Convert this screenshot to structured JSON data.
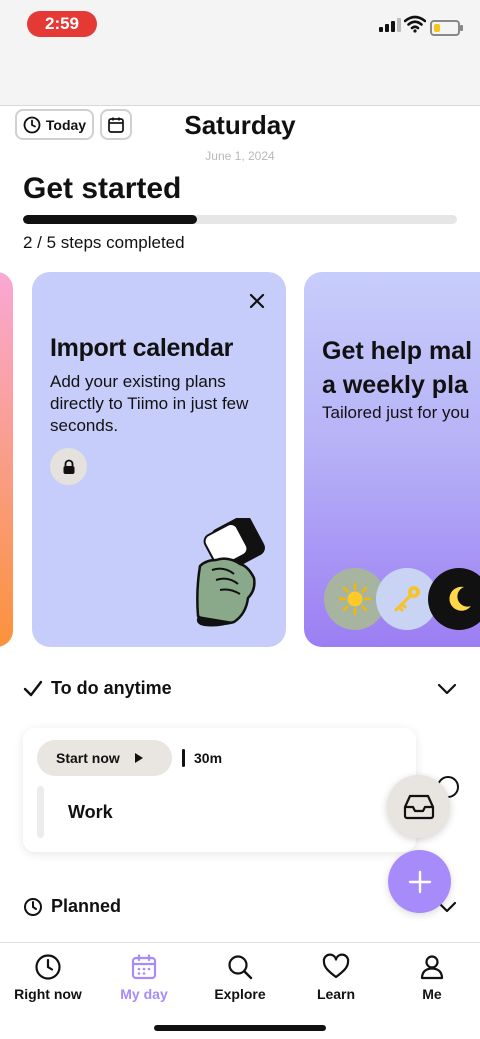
{
  "status_bar": {
    "time": "2:59"
  },
  "header": {
    "today_label": "Today",
    "day": "Saturday",
    "date": "June 1, 2024"
  },
  "onboarding": {
    "title": "Get started",
    "progress_fraction": 0.4,
    "steps_text": "2 / 5 steps completed"
  },
  "cards": [
    {
      "title": "Import calendar",
      "body": "Add your existing plans directly to Tiimo in just few seconds."
    },
    {
      "title_line1": "Get help mal",
      "title_line2": "a weekly pla",
      "body": "Tailored just for you"
    }
  ],
  "sections": {
    "anytime": "To do anytime",
    "planned": "Planned"
  },
  "task": {
    "start_label": "Start now",
    "duration": "30m",
    "title": "Work"
  },
  "tabs": [
    {
      "label": "Right now",
      "icon": "clock-icon"
    },
    {
      "label": "My day",
      "icon": "calendar-icon",
      "active": true
    },
    {
      "label": "Explore",
      "icon": "search-icon"
    },
    {
      "label": "Learn",
      "icon": "heart-icon"
    },
    {
      "label": "Me",
      "icon": "person-icon"
    }
  ],
  "colors": {
    "accent": "#a78bfa",
    "card_blue": "#c7cdfb",
    "status_red": "#e53935"
  }
}
